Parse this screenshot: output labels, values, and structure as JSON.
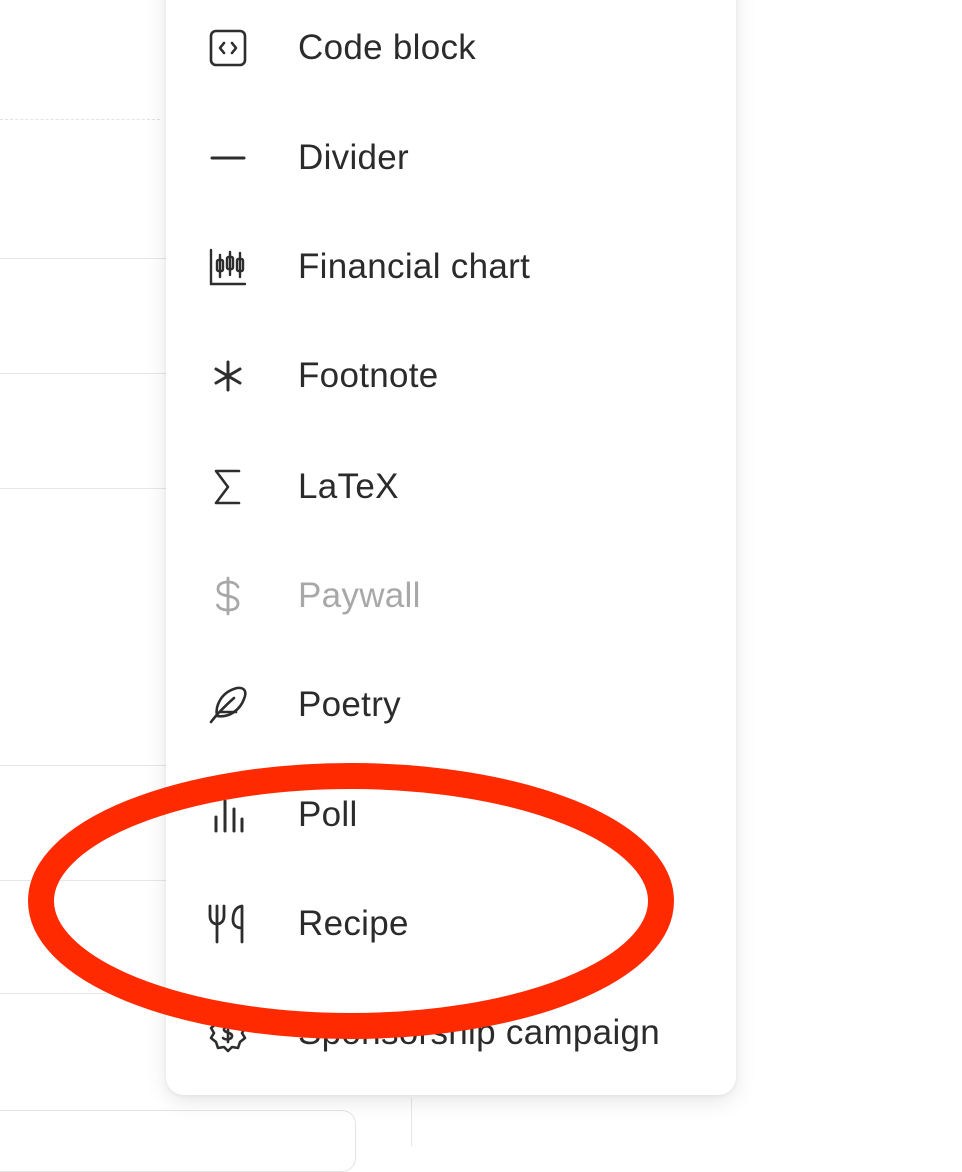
{
  "menu": {
    "items": [
      {
        "label": "Code block",
        "icon": "code-block-icon",
        "disabled": false
      },
      {
        "label": "Divider",
        "icon": "divider-icon",
        "disabled": false
      },
      {
        "label": "Financial chart",
        "icon": "financial-chart-icon",
        "disabled": false
      },
      {
        "label": "Footnote",
        "icon": "asterisk-icon",
        "disabled": false
      },
      {
        "label": "LaTeX",
        "icon": "sigma-icon",
        "disabled": false
      },
      {
        "label": "Paywall",
        "icon": "dollar-icon",
        "disabled": true
      },
      {
        "label": "Poetry",
        "icon": "feather-icon",
        "disabled": false
      },
      {
        "label": "Poll",
        "icon": "bar-chart-icon",
        "disabled": false
      },
      {
        "label": "Recipe",
        "icon": "fork-knife-icon",
        "disabled": false
      },
      {
        "label": "Sponsorship campaign",
        "icon": "badge-dollar-icon",
        "disabled": false
      }
    ]
  },
  "colors": {
    "text": "#2b2b2b",
    "disabled_text": "#a8a8a8",
    "annotation": "#ff2a00"
  }
}
